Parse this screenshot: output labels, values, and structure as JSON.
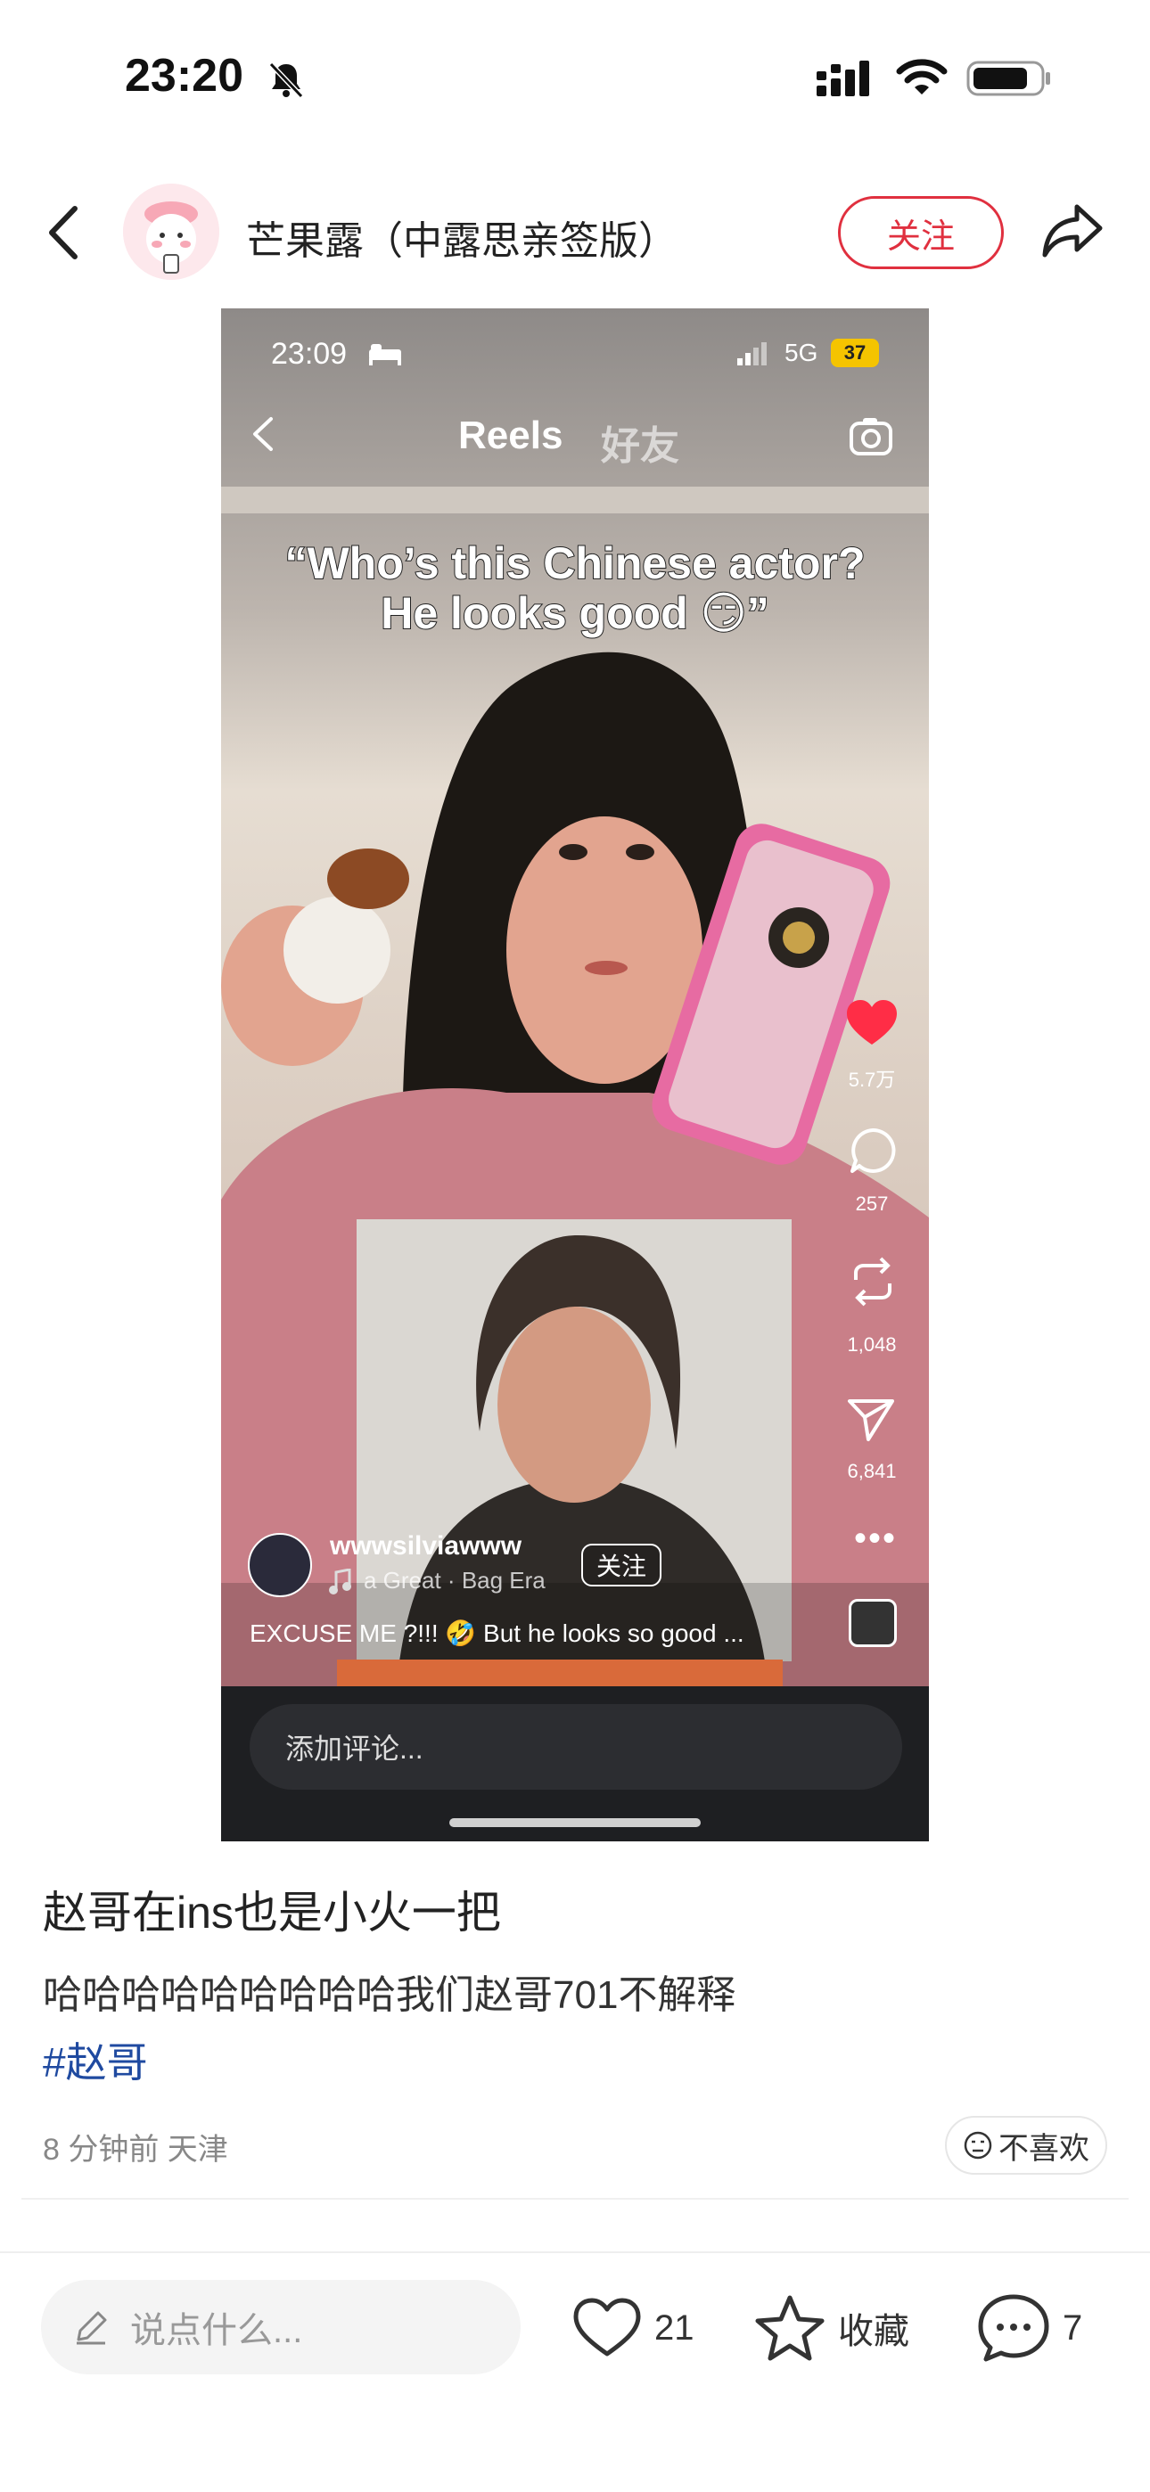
{
  "status_bar": {
    "time": "23:20"
  },
  "header": {
    "author_name": "芒果露（中露思亲签版）",
    "follow_label": "关注"
  },
  "media": {
    "status_time": "23:09",
    "network": "5G",
    "battery": "37",
    "tabs": [
      "Reels",
      "好友"
    ],
    "caption_line1": "“Who’s this Chinese actor?",
    "caption_line2": "He looks good 😏”",
    "like_count": "5.7万",
    "comment_count": "257",
    "repost_count": "1,048",
    "share_count": "6,841",
    "more": "•••",
    "username": "wwwsilviawww",
    "follow_label": "关注",
    "music": "a Great · Bag Era",
    "description": "EXCUSE ME ?!!! 🤣 But he looks so good ...",
    "comment_placeholder": "添加评论..."
  },
  "post": {
    "title": "赵哥在ins也是小火一把",
    "body": "哈哈哈哈哈哈哈哈哈我们赵哥701不解释",
    "hashtag": "#赵哥",
    "meta": "8 分钟前  天津",
    "dislike_label": "不喜欢"
  },
  "bottom_bar": {
    "comment_placeholder": "说点什么...",
    "like_count": "21",
    "collect_label": "收藏",
    "comment_count": "7"
  },
  "colors": {
    "accent": "#e0303f",
    "hashtag": "#1f4aa0",
    "media_bar": "#1e1f22"
  }
}
